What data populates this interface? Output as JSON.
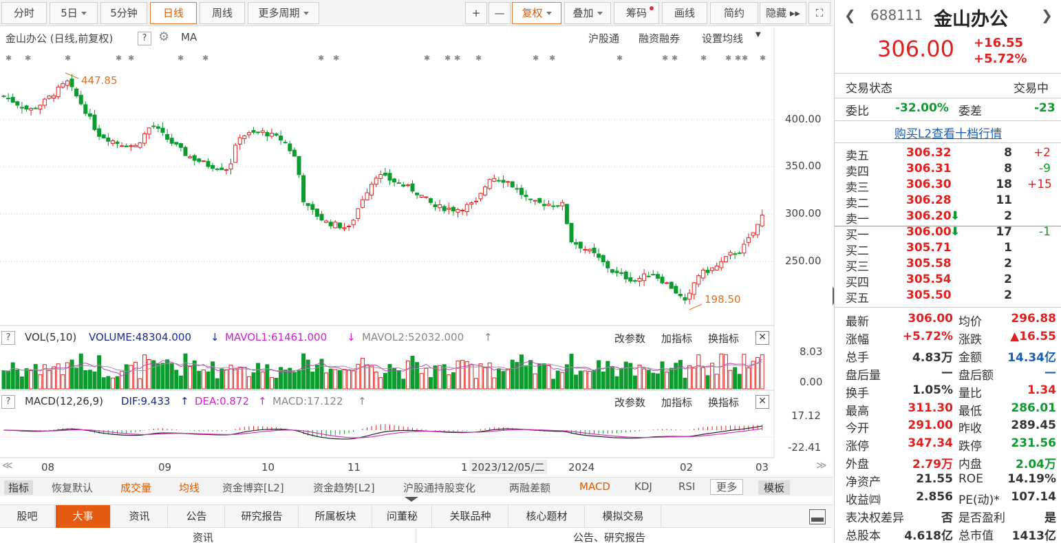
{
  "toolbar": {
    "periods": [
      "分时",
      "5日",
      "5分钟",
      "日线",
      "周线",
      "更多周期"
    ],
    "tools": [
      "+",
      "—",
      "复权",
      "叠加",
      "筹码",
      "画线",
      "简约",
      "隐藏 ▸▸"
    ]
  },
  "chart": {
    "title": "金山办公 (日线,前复权)",
    "ma_label": "MA",
    "links": [
      "沪股通",
      "融资融券",
      "设置均线"
    ],
    "price_ticks": [
      "400.00",
      "350.00",
      "300.00",
      "250.00"
    ],
    "high_annotation": "447.85",
    "low_annotation": "198.50",
    "x_labels": [
      "08",
      "09",
      "10",
      "11",
      "1",
      "2023/12/05/二",
      "2024",
      "02",
      "03"
    ]
  },
  "volume": {
    "label": "VOL(5,10)",
    "volume": "VOLUME:48304.000",
    "mavol1": "MAVOL1:61461.000",
    "mavol2": "MAVOL2:52032.000",
    "actions": [
      "改参数",
      "加指标",
      "换指标"
    ],
    "ticks": [
      "8.03",
      "0.00"
    ]
  },
  "macd": {
    "label": "MACD(12,26,9)",
    "dif": "DIF:9.433",
    "dea": "DEA:0.872",
    "macd": "MACD:17.122",
    "actions": [
      "改参数",
      "加指标",
      "换指标"
    ],
    "ticks": [
      "17.12",
      "-22.41"
    ]
  },
  "indicator_bar": [
    "指标",
    "恢复默认",
    "成交量",
    "均线",
    "资金博弈[L2]",
    "资金趋势[L2]",
    "沪股通持股变化",
    "两融差额",
    "MACD",
    "KDJ",
    "RSI",
    "更多",
    "模板"
  ],
  "bottom_tabs": [
    "股吧",
    "大事",
    "资讯",
    "公告",
    "研究报告",
    "所属板块",
    "问董秘",
    "关联品种",
    "核心题材",
    "模拟交易"
  ],
  "bottom_row": [
    "资讯",
    "公告、研究报告"
  ],
  "quote": {
    "code": "688111",
    "name": "金山办公",
    "price": "306.00",
    "change": "+16.55",
    "change_pct": "+5.72%",
    "status_label": "交易状态",
    "status": "交易中",
    "weibi_label": "委比",
    "weibi": "-32.00%",
    "weicha_label": "委差",
    "weicha": "-23",
    "l2_link": "购买L2查看十档行情",
    "asks": [
      {
        "label": "卖五",
        "price": "306.32",
        "vol": "8",
        "chg": "+2"
      },
      {
        "label": "卖四",
        "price": "306.31",
        "vol": "8",
        "chg": "-9"
      },
      {
        "label": "卖三",
        "price": "306.30",
        "vol": "18",
        "chg": "+15"
      },
      {
        "label": "卖二",
        "price": "306.28",
        "vol": "11",
        "chg": ""
      },
      {
        "label": "卖一",
        "price": "306.20",
        "vol": "2",
        "chg": ""
      }
    ],
    "bids": [
      {
        "label": "买一",
        "price": "306.00",
        "vol": "17",
        "chg": "-1"
      },
      {
        "label": "买二",
        "price": "305.71",
        "vol": "1",
        "chg": ""
      },
      {
        "label": "买三",
        "price": "305.58",
        "vol": "2",
        "chg": ""
      },
      {
        "label": "买四",
        "price": "305.54",
        "vol": "2",
        "chg": ""
      },
      {
        "label": "买五",
        "price": "305.50",
        "vol": "2",
        "chg": ""
      }
    ],
    "stats": [
      {
        "l1": "最新",
        "v1": "306.00",
        "l2": "均价",
        "v2": "296.88"
      },
      {
        "l1": "涨幅",
        "v1": "+5.72%",
        "l2": "涨跌",
        "v2": "▲16.55"
      },
      {
        "l1": "总手",
        "v1": "4.83万",
        "l2": "金额",
        "v2": "14.34亿"
      },
      {
        "l1": "盘后量",
        "v1": "—",
        "l2": "盘后额",
        "v2": "—"
      },
      {
        "l1": "换手",
        "v1": "1.05%",
        "l2": "量比",
        "v2": "1.34"
      },
      {
        "l1": "最高",
        "v1": "311.30",
        "l2": "最低",
        "v2": "286.01"
      },
      {
        "l1": "今开",
        "v1": "291.00",
        "l2": "昨收",
        "v2": "289.45"
      },
      {
        "l1": "涨停",
        "v1": "347.34",
        "l2": "跌停",
        "v2": "231.56"
      },
      {
        "l1": "外盘",
        "v1": "2.79万",
        "l2": "内盘",
        "v2": "2.04万"
      },
      {
        "l1": "净资产",
        "v1": "21.55",
        "l2": "ROE",
        "v2": "14.19%"
      },
      {
        "l1": "收益㈣",
        "v1": "2.856",
        "l2": "PE(动)*",
        "v2": "107.14"
      },
      {
        "l1": "表决权差异",
        "v1": "否",
        "l2": "是否盈利",
        "v2": "是"
      },
      {
        "l1": "总股本",
        "v1": "4.618亿",
        "l2": "总市值",
        "v2": "1413亿"
      }
    ]
  },
  "colors": {
    "up": "#e0201e",
    "down": "#0c9b2e",
    "accent": "#e35a10"
  }
}
